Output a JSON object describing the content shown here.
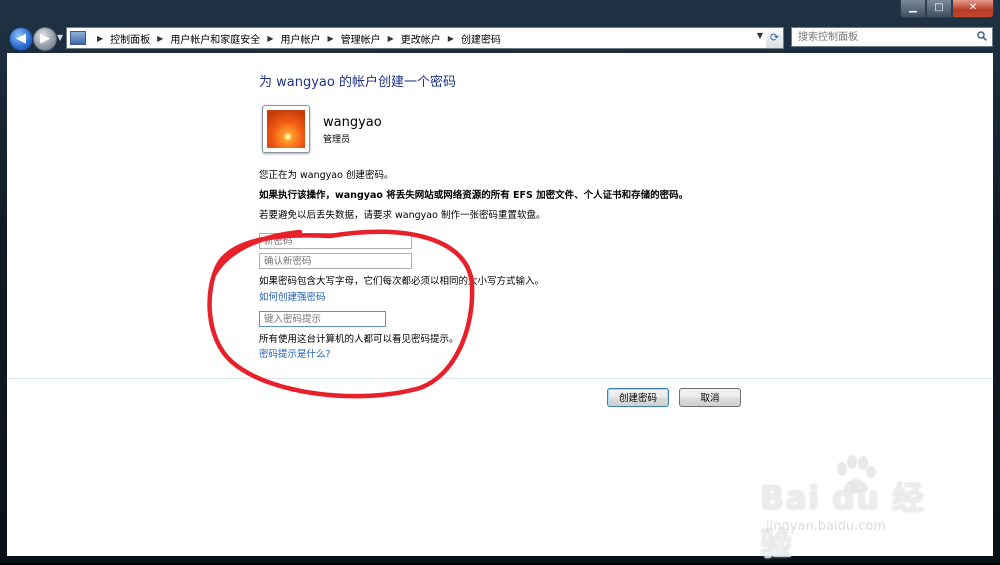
{
  "window": {
    "caption_buttons": {
      "minimize": "▁",
      "maximize": "□",
      "close": "✕"
    }
  },
  "address_bar": {
    "breadcrumbs": [
      "控制面板",
      "用户帐户和家庭安全",
      "用户帐户",
      "管理帐户",
      "更改帐户",
      "创建密码"
    ],
    "separator": "▶"
  },
  "search": {
    "placeholder": "搜索控制面板"
  },
  "page": {
    "title": "为 wangyao 的帐户创建一个密码",
    "user": {
      "name": "wangyao",
      "role": "管理员"
    },
    "info_line": "您正在为 wangyao 创建密码。",
    "warning_line": "如果执行该操作，wangyao 将丢失网站或网络资源的所有 EFS 加密文件、个人证书和存储的密码。",
    "reset_disk_line": "若要避免以后丢失数据，请要求 wangyao 制作一张密码重置软盘。",
    "new_password_placeholder": "新密码",
    "confirm_password_placeholder": "确认新密码",
    "case_note": "如果密码包含大写字母，它们每次都必须以相同的大小写方式输入。",
    "strong_password_link": "如何创建强密码",
    "hint_placeholder": "键入密码提示",
    "hint_note": "所有使用这台计算机的人都可以看见密码提示。",
    "hint_link": "密码提示是什么?",
    "create_button": "创建密码",
    "cancel_button": "取消"
  },
  "watermark": {
    "main": "Bai du 经验",
    "sub": "jingyan.baidu.com"
  },
  "colors": {
    "title": "#1e3287",
    "link": "#1f5fbf",
    "annotation_oval": "#e8202a"
  }
}
